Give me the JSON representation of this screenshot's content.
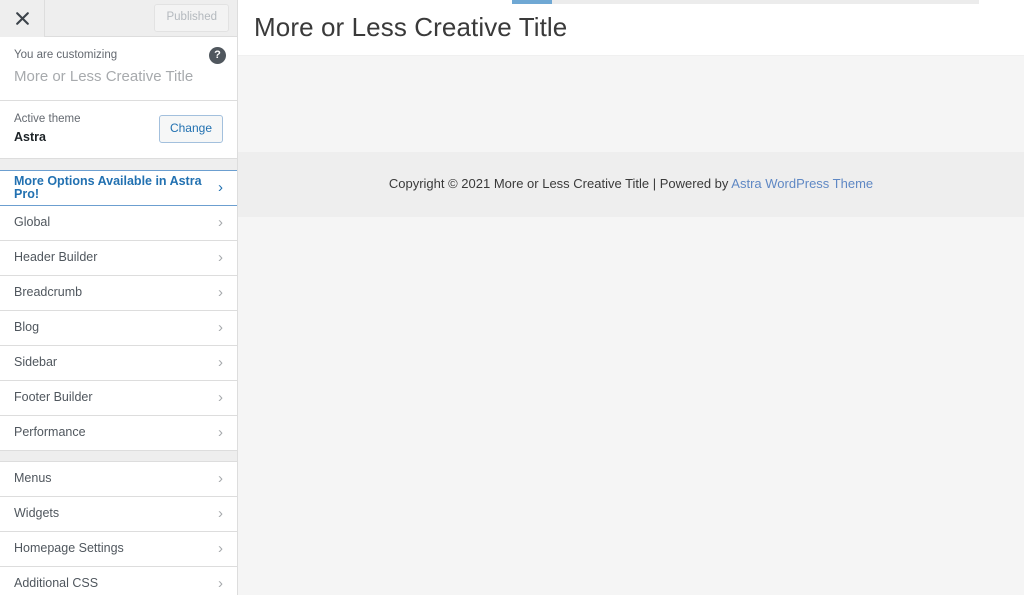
{
  "customizer": {
    "topbar": {
      "close_icon": "close-icon",
      "publish_label": "Published"
    },
    "info": {
      "eyebrow": "You are customizing",
      "site_title": "More or Less Creative Title",
      "help_glyph": "?"
    },
    "theme": {
      "label": "Active theme",
      "name": "Astra",
      "change_label": "Change"
    },
    "menu_items": [
      {
        "label": "More Options Available in Astra Pro!",
        "arrow": "›",
        "highlight": true
      },
      {
        "label": "Global",
        "arrow": "›"
      },
      {
        "label": "Header Builder",
        "arrow": "›"
      },
      {
        "label": "Breadcrumb",
        "arrow": "›"
      },
      {
        "label": "Blog",
        "arrow": "›"
      },
      {
        "label": "Sidebar",
        "arrow": "›"
      },
      {
        "label": "Footer Builder",
        "arrow": "›"
      },
      {
        "label": "Performance",
        "arrow": "›"
      },
      {
        "label": "Menus",
        "arrow": "›"
      },
      {
        "label": "Widgets",
        "arrow": "›"
      },
      {
        "label": "Homepage Settings",
        "arrow": "›"
      },
      {
        "label": "Additional CSS",
        "arrow": "›"
      }
    ]
  },
  "preview": {
    "loading_progress_percent": 9,
    "site_title": "More or Less Creative Title",
    "footer": {
      "copyright_text": "Copyright © 2021 More or Less Creative Title | Powered by ",
      "link_label": "Astra WordPress Theme"
    }
  },
  "colors": {
    "accent_blue": "#2271b1",
    "progress_blue": "#6fa8d4",
    "link_blue": "#5f88c4",
    "sidebar_bg": "#eeeeee",
    "panel_bg": "#ffffff",
    "preview_bg": "#f5f5f5",
    "footer_bg": "#eeeeee"
  }
}
